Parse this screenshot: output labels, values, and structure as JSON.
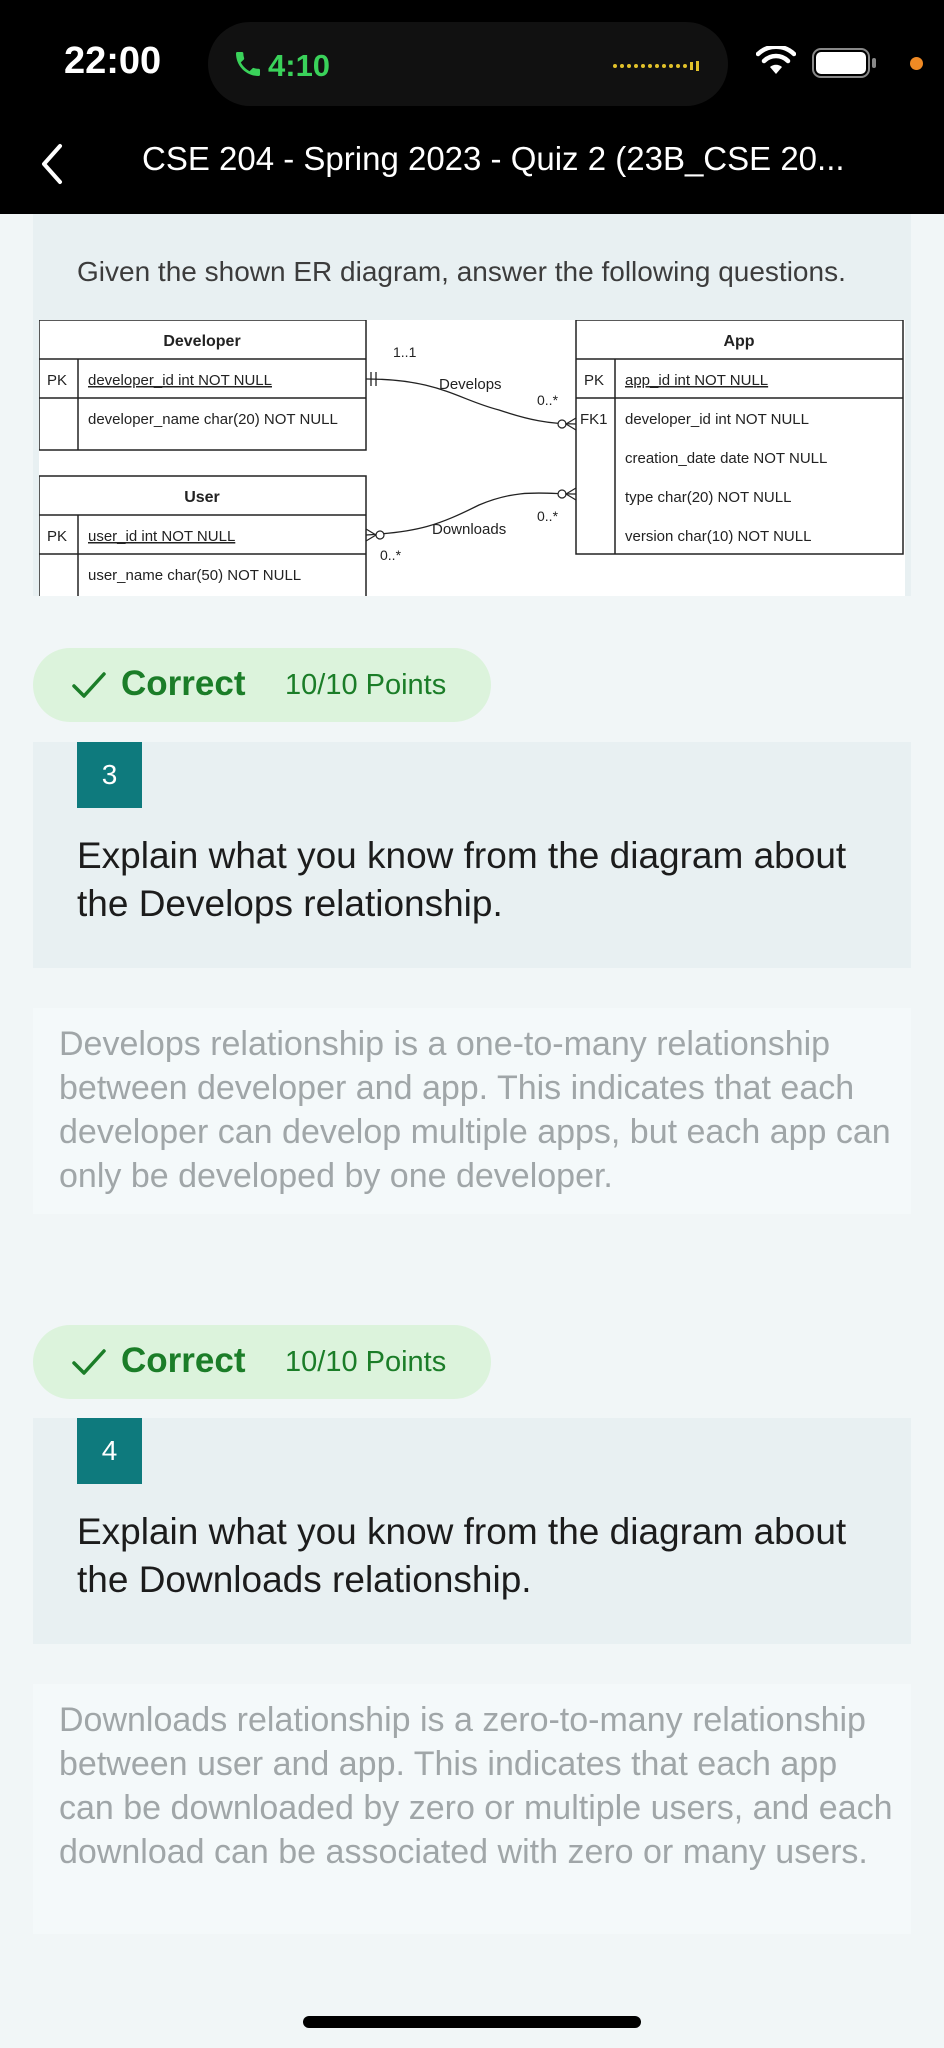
{
  "status_bar": {
    "time": "22:00",
    "call_duration": "4:10",
    "icons": [
      "phone-icon",
      "wifi-icon",
      "battery-icon"
    ]
  },
  "nav": {
    "title": "CSE 204 - Spring 2023 - Quiz 2 (23B_CSE 20..."
  },
  "intro": {
    "text": "Given the shown ER diagram, answer the following questions."
  },
  "er_diagram": {
    "developer": {
      "title": "Developer",
      "pk": "PK",
      "pk_field": "developer_id int NOT NULL",
      "field": "developer_name char(20) NOT NULL"
    },
    "user": {
      "title": "User",
      "pk": "PK",
      "pk_field": "user_id int NOT NULL",
      "field": "user_name char(50) NOT NULL"
    },
    "app": {
      "title": "App",
      "pk": "PK",
      "pk_field": "app_id int NOT NULL",
      "fk": "FK1",
      "fields": [
        "developer_id int NOT NULL",
        "creation_date date NOT NULL",
        "type char(20) NOT NULL",
        "version char(10) NOT NULL"
      ]
    },
    "develops": {
      "label": "Develops",
      "left_card": "1..1",
      "right_card": "0..*"
    },
    "downloads": {
      "label": "Downloads",
      "left_card": "0..*",
      "right_card": "0..*"
    }
  },
  "questions": [
    {
      "result": "Correct",
      "points": "10/10 Points",
      "number": "3",
      "prompt": "Explain what you know from the diagram about the Develops relationship.",
      "answer": "Develops relationship is a one-to-many relationship between developer and app. This indicates that each developer can develop multiple apps, but each app can only be developed by one developer."
    },
    {
      "result": "Correct",
      "points": "10/10 Points",
      "number": "4",
      "prompt": "Explain what you know from the diagram about the Downloads relationship.",
      "answer": "Downloads relationship is a zero-to-many relationship between user and app. This indicates that each app can be downloaded by zero or multiple users, and each download can be associated with zero or many users."
    }
  ],
  "colors": {
    "accent": "#0e7a7d",
    "correct_text": "#1b7d28",
    "correct_bg": "#dcf3dc",
    "call_green": "#3ad25a"
  }
}
